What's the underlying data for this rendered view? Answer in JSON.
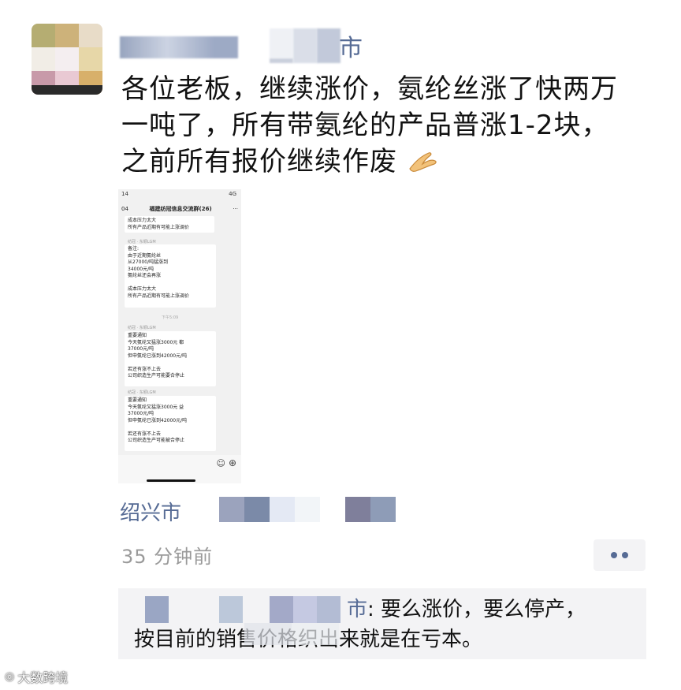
{
  "post": {
    "author_suffix": "市",
    "lines": [
      "各位老板，继续涨价，氨纶丝涨了快两万",
      "一吨了，所有带氨纶的产品普涨1-2块，",
      "之前所有报价继续作废"
    ],
    "emoji": "pray-hands-icon",
    "location": "绍兴市",
    "time": "35 分钟前"
  },
  "embedded_screenshot": {
    "status_time": "14",
    "status_net": "4G",
    "back_count": "04",
    "group_title": "福建纺冠信息交流群(26)",
    "messages": [
      {
        "text": "成本压力太大\n所有产品近期有可能上涨调价"
      },
      {
        "sender": "纺冠 · 东颖LGM",
        "text": "备注:\n由于近期氨纶丝\n从27000/吨猛涨到\n34000元/吨\n氨纶丝还会再涨\n\n成本压力太大\n所有产品近期有可能上涨调价"
      },
      {
        "timestamp": "下午5:09"
      },
      {
        "sender": "纺冠 · 东颖LGM",
        "text": "      重要通知\n今天氨纶又猛涨3000元       都\n37000元/吨\n但申氨纶已涨到42000元/吨\n\n若还有涨不上去\n公司织造生产可能要合停止"
      },
      {
        "sender": "纺冠 · 东颖LGM",
        "text": "      重要通知\n今天氨纶又猛涨3000元      益\n37000元/吨\n但申氨纶已涨到42000元/吨\n\n若还有涨不上去\n公司织造生产可能被合停止"
      }
    ]
  },
  "comment": {
    "name_suffix": "市",
    "text_line1": ": 要么涨价，要么停产，",
    "text_line2": "按目前的销售价格织出来就是在亏本。"
  },
  "watermark": "大数跨境",
  "colors": {
    "link": "#566b95",
    "time": "#9a9a9a",
    "comment_bg": "#f3f3f5"
  }
}
